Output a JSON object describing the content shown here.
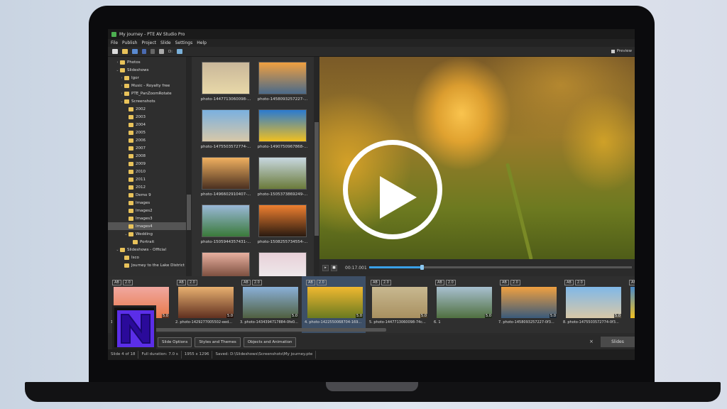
{
  "window": {
    "title": "My journey - PTE AV Studio Pro"
  },
  "menu": [
    "File",
    "Publish",
    "Project",
    "Slide",
    "Settings",
    "Help"
  ],
  "toolbar": {
    "drive_label": "D:",
    "preview_label": "Preview"
  },
  "folder_tree": [
    {
      "label": "Photos",
      "indent": 1,
      "chev": "›"
    },
    {
      "label": "Slideshows",
      "indent": 1,
      "chev": "⌄"
    },
    {
      "label": "Igor",
      "indent": 2,
      "chev": "›"
    },
    {
      "label": "Music - Royalty free",
      "indent": 2,
      "chev": "›"
    },
    {
      "label": "PTE_PanZoomRotate",
      "indent": 2,
      "chev": "›"
    },
    {
      "label": "Screenshots",
      "indent": 2,
      "chev": "⌄"
    },
    {
      "label": "2002",
      "indent": 3,
      "chev": ""
    },
    {
      "label": "2003",
      "indent": 3,
      "chev": ""
    },
    {
      "label": "2004",
      "indent": 3,
      "chev": ""
    },
    {
      "label": "2005",
      "indent": 3,
      "chev": ""
    },
    {
      "label": "2006",
      "indent": 3,
      "chev": ""
    },
    {
      "label": "2007",
      "indent": 3,
      "chev": ""
    },
    {
      "label": "2008",
      "indent": 3,
      "chev": ""
    },
    {
      "label": "2009",
      "indent": 3,
      "chev": ""
    },
    {
      "label": "2010",
      "indent": 3,
      "chev": ""
    },
    {
      "label": "2011",
      "indent": 3,
      "chev": ""
    },
    {
      "label": "2012",
      "indent": 3,
      "chev": ""
    },
    {
      "label": "Demo 9",
      "indent": 3,
      "chev": ""
    },
    {
      "label": "Images",
      "indent": 3,
      "chev": ""
    },
    {
      "label": "Images2",
      "indent": 3,
      "chev": ""
    },
    {
      "label": "Images3",
      "indent": 3,
      "chev": ""
    },
    {
      "label": "Images4",
      "indent": 3,
      "chev": "",
      "selected": true
    },
    {
      "label": "Wedding",
      "indent": 3,
      "chev": "⌄"
    },
    {
      "label": "Portrait",
      "indent": 4,
      "chev": ""
    },
    {
      "label": "Slideshows - Official",
      "indent": 1,
      "chev": "⌄"
    },
    {
      "label": "Isco",
      "indent": 2,
      "chev": ""
    },
    {
      "label": "Journey to the Lake District",
      "indent": 2,
      "chev": ""
    }
  ],
  "files": [
    {
      "label": "photo-1447713060098-...",
      "c1": "#c9b79a",
      "c2": "#e8d8a8"
    },
    {
      "label": "photo-1458093257227-...",
      "c1": "#f0a040",
      "c2": "#4a6a8a"
    },
    {
      "label": "photo-1475503572774-...",
      "c1": "#7ab0e0",
      "c2": "#d8c8a8"
    },
    {
      "label": "photo-1490750967868-...",
      "c1": "#2a7ad0",
      "c2": "#f0c020"
    },
    {
      "label": "photo-1496602910407-...",
      "c1": "#f0b060",
      "c2": "#4a3020"
    },
    {
      "label": "photo-1505373869249-...",
      "c1": "#c8d8e0",
      "c2": "#6a7a3a"
    },
    {
      "label": "photo-1505944357431-...",
      "c1": "#9ab8d8",
      "c2": "#3a7a3a"
    },
    {
      "label": "photo-1508255734554-...",
      "c1": "#f08030",
      "c2": "#2a1a10"
    },
    {
      "label": "",
      "c1": "#e8b0a0",
      "c2": "#5a3020"
    },
    {
      "label": "",
      "c1": "#e8d0d8",
      "c2": "#f0f0f0"
    }
  ],
  "transport": {
    "timecode": "00:17.001",
    "progress": 0.2
  },
  "slides": [
    {
      "label": "1. photo-...el_1...",
      "duration": "5.0",
      "c1": "#f0a8a0",
      "c2": "#e87848"
    },
    {
      "label": "2. photo-1429277005502-eed...",
      "duration": "5.0",
      "c1": "#e8b070",
      "c2": "#603020"
    },
    {
      "label": "3. photo-1434394717884-0fe0...",
      "duration": "5.0",
      "c1": "#8ab0d8",
      "c2": "#506040"
    },
    {
      "label": "4. photo-1422550068704-169...",
      "duration": "5.0",
      "c1": "#f0b830",
      "c2": "#6a7a20",
      "active": true
    },
    {
      "label": "5. photo-1447713060098-74c...",
      "duration": "5.0",
      "c1": "#c8b890",
      "c2": "#a89060"
    },
    {
      "label": "6. 1",
      "duration": "5.0",
      "c1": "#a8c0d0",
      "c2": "#507040"
    },
    {
      "label": "7. photo-1458093257227-0f3...",
      "duration": "5.0",
      "c1": "#f0a040",
      "c2": "#3a5a7a"
    },
    {
      "label": "8. photo-1475503572774-0f3...",
      "duration": "5.0",
      "c1": "#80b8e8",
      "c2": "#d8c8a8"
    },
    {
      "label": "",
      "duration": "",
      "c1": "#4a8ac8",
      "c2": "#f0c020"
    }
  ],
  "slide_tags": {
    "ab": "AB",
    "dur": "2.0"
  },
  "logo": {
    "letter": "N"
  },
  "bottom_buttons": [
    "Slide Options",
    "Styles and Themes",
    "Objects and Animation"
  ],
  "close_label": "×",
  "slides_tab": "Slides",
  "status": [
    "Slide 4 of 18",
    "Full duration: 7.0 s",
    "1955 x 1296",
    "Saved: D:\\Slideshows\\Screenshots\\My journey.pte"
  ]
}
